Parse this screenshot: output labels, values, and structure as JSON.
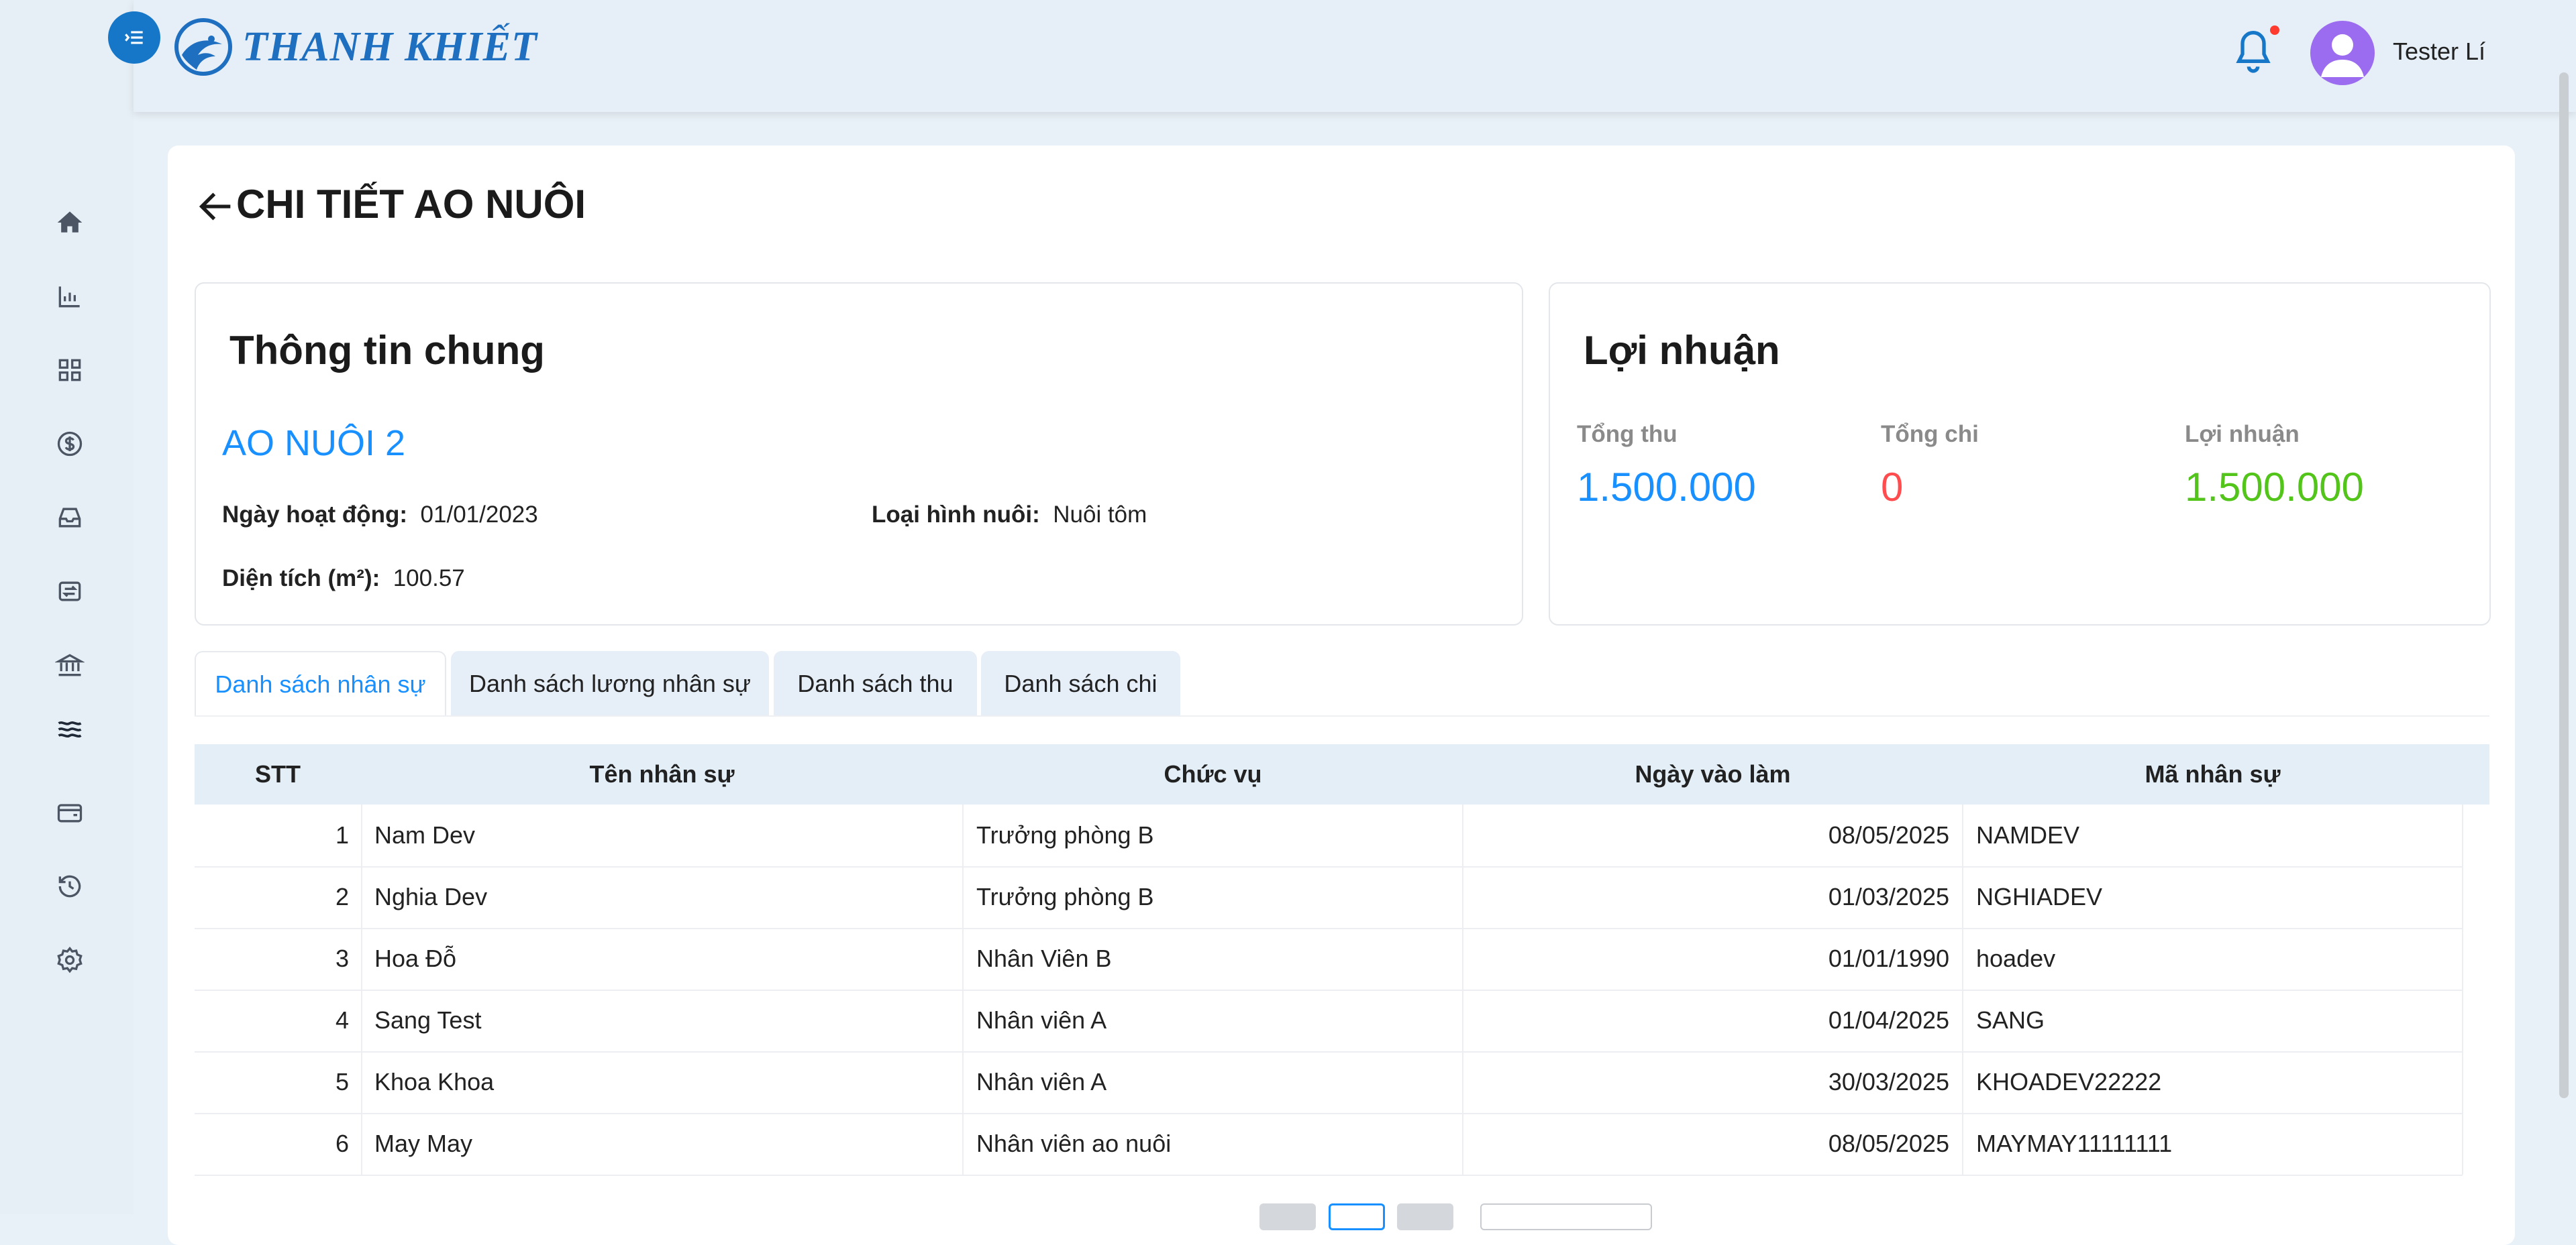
{
  "app": {
    "brand": "THANH KHIẾT"
  },
  "header": {
    "username": "Tester Lí"
  },
  "page": {
    "title": "CHI TIẾT AO NUÔI"
  },
  "general": {
    "title": "Thông tin chung",
    "pond_name": "AO NUÔI 2",
    "active_date_label": "Ngày hoạt động:",
    "active_date": "01/01/2023",
    "farm_type_label": "Loại hình nuôi:",
    "farm_type": "Nuôi tôm",
    "area_label": "Diện tích (m²):",
    "area": "100.57"
  },
  "profit": {
    "title": "Lợi nhuận",
    "income_label": "Tổng thu",
    "income": "1.500.000",
    "expense_label": "Tổng chi",
    "expense": "0",
    "profit_label": "Lợi nhuận",
    "profit": "1.500.000",
    "colors": {
      "income": "#1890ff",
      "expense": "#ff4d4f",
      "profit": "#52c41a"
    }
  },
  "tabs": [
    {
      "label": "Danh sách nhân sự",
      "active": true
    },
    {
      "label": "Danh sách lương nhân sự",
      "active": false
    },
    {
      "label": "Danh sách thu",
      "active": false
    },
    {
      "label": "Danh sách chi",
      "active": false
    }
  ],
  "table": {
    "headers": [
      "STT",
      "Tên nhân sự",
      "Chức vụ",
      "Ngày vào làm",
      "Mã nhân sự"
    ],
    "rows": [
      [
        "1",
        "Nam Dev",
        "Trưởng phòng B",
        "08/05/2025",
        "NAMDEV"
      ],
      [
        "2",
        "Nghia Dev",
        "Trưởng phòng B",
        "01/03/2025",
        "NGHIADEV"
      ],
      [
        "3",
        "Hoa Đỗ",
        "Nhân Viên B",
        "01/01/1990",
        "hoadev"
      ],
      [
        "4",
        "Sang Test",
        "Nhân viên A",
        "01/04/2025",
        "SANG"
      ],
      [
        "5",
        "Khoa Khoa",
        "Nhân viên A",
        "30/03/2025",
        "KHOADEV22222"
      ],
      [
        "6",
        "May May",
        "Nhân viên ao nuôi",
        "08/05/2025",
        "MAYMAY11111111"
      ]
    ]
  },
  "icons": [
    "menu-icon",
    "home-icon",
    "chart-icon",
    "grid-icon",
    "dollar-icon",
    "inbox-icon",
    "transfer-icon",
    "bank-icon",
    "water-icon",
    "wallet-icon",
    "history-icon",
    "settings-icon",
    "bell-icon",
    "user-icon",
    "back-arrow-icon"
  ]
}
